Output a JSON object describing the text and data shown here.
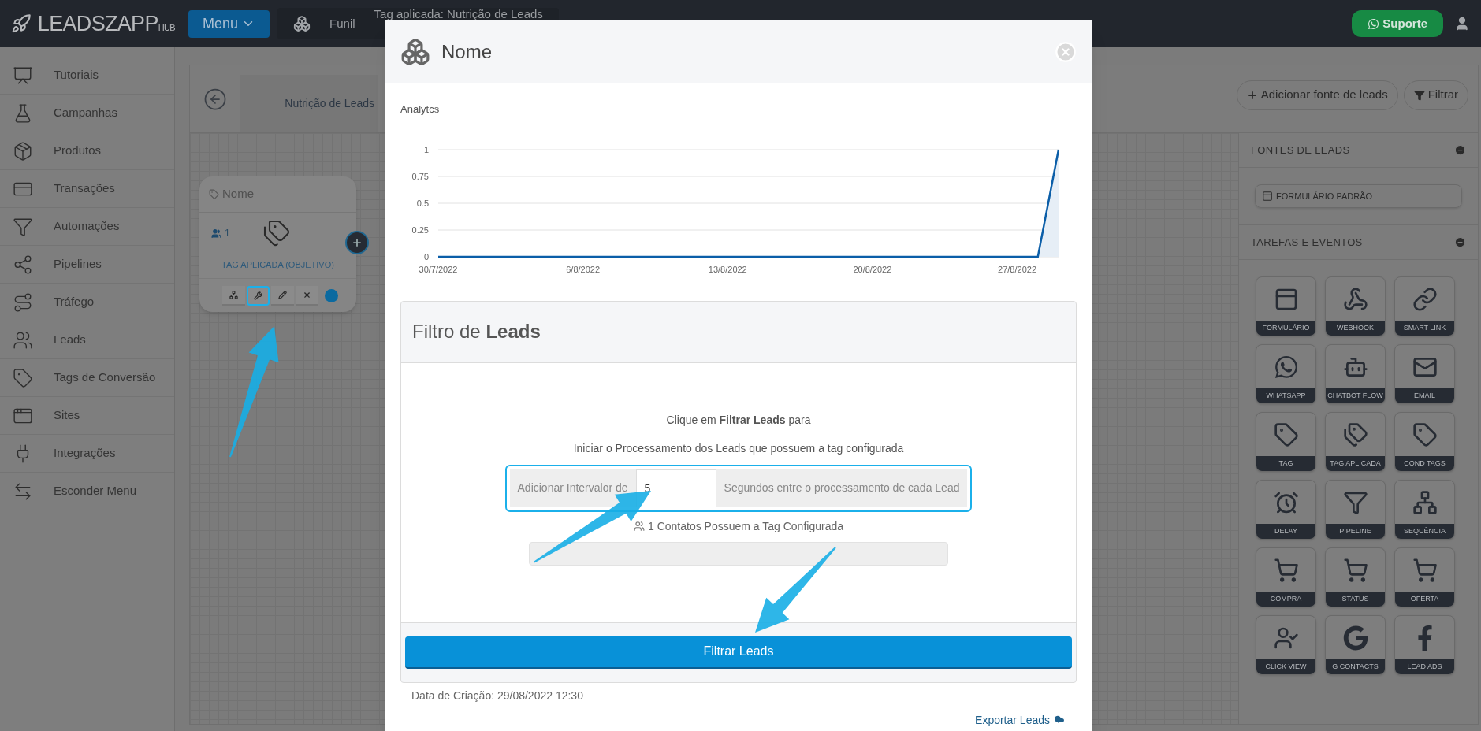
{
  "top_bar": {
    "logo": {
      "name": "LEADSZAPP",
      "suffix": "HUB"
    },
    "menu_button": "Menu",
    "breadcrumbs": [
      "Funil",
      "Tag aplicada: Nutrição de Leads"
    ],
    "support_button": "Suporte"
  },
  "sidebar": {
    "items": [
      "Tutoriais",
      "Campanhas",
      "Produtos",
      "Transações",
      "Automações",
      "Pipelines",
      "Tráfego",
      "Leads",
      "Tags de Conversão",
      "Sites",
      "Integrações",
      "Esconder Menu"
    ]
  },
  "canvas": {
    "tab": "Nutrição de Leads",
    "toolbar": [
      "Adicionar fonte de leads",
      "Filtrar"
    ],
    "node": {
      "title": "Nome",
      "count": "1",
      "type_label": "TAG APLICADA (OBJETIVO)",
      "tools": [
        {
          "highlighted": false
        },
        {
          "highlighted": true
        },
        {
          "highlighted": false
        },
        {
          "highlighted": false
        }
      ]
    }
  },
  "right_panel": {
    "sections": [
      {
        "title": "FONTES DE LEADS",
        "expanded": true,
        "items": [
          "FORMULÁRIO PADRÃO"
        ]
      },
      {
        "title": "TAREFAS E EVENTOS",
        "expanded": true,
        "items": [
          "FORMULÁRIO",
          "WEBHOOK",
          "SMART LINK",
          "WHATSAPP",
          "CHATBOT FLOW",
          "EMAIL",
          "TAG",
          "TAG APLICADA",
          "COND TAGS",
          "DELAY",
          "PIPELINE",
          "SEQUÊNCIA",
          "COMPRA",
          "STATUS",
          "OFERTA",
          "CLICK VIEW",
          "G CONTACTS",
          "LEAD ADS"
        ]
      }
    ]
  },
  "modal": {
    "title": "Nome",
    "analytics_label": "Analytcs",
    "chart_data": {
      "type": "area",
      "categories": [
        "30/7/2022",
        null,
        null,
        null,
        null,
        null,
        null,
        "6/8/2022",
        null,
        null,
        null,
        null,
        null,
        null,
        "13/8/2022",
        null,
        null,
        null,
        null,
        null,
        null,
        "20/8/2022",
        null,
        null,
        null,
        null,
        null,
        null,
        "27/8/2022",
        null,
        null
      ],
      "values": [
        0,
        0,
        0,
        0,
        0,
        0,
        0,
        0,
        0,
        0,
        0,
        0,
        0,
        0,
        0,
        0,
        0,
        0,
        0,
        0,
        0,
        0,
        0,
        0,
        0,
        0,
        0,
        0,
        0,
        0,
        1
      ],
      "ylim": [
        0,
        1
      ],
      "grid": true,
      "yticks": [
        0,
        0.25,
        0.5,
        0.75,
        1
      ]
    },
    "filter": {
      "title": "Filtro de **Leads**",
      "instruction": "Clique em **Filtrar Leads** para",
      "instruction_2": "Iniciar o Processamento dos Leads que possuem a tag configurada",
      "interval": {
        "prefix": "Adicionar Intervalor de",
        "value": "5",
        "suffix": "Segundos entre o processamento de cada Lead",
        "highlighted": true
      },
      "contacts": "1 Contatos Possuem a Tag Configurada",
      "progress": {
        "level": 0
      },
      "button": "Filtrar Leads"
    },
    "created": "Data de Criação: 29/08/2022 12:30",
    "export_link": "Exportar Leads"
  }
}
